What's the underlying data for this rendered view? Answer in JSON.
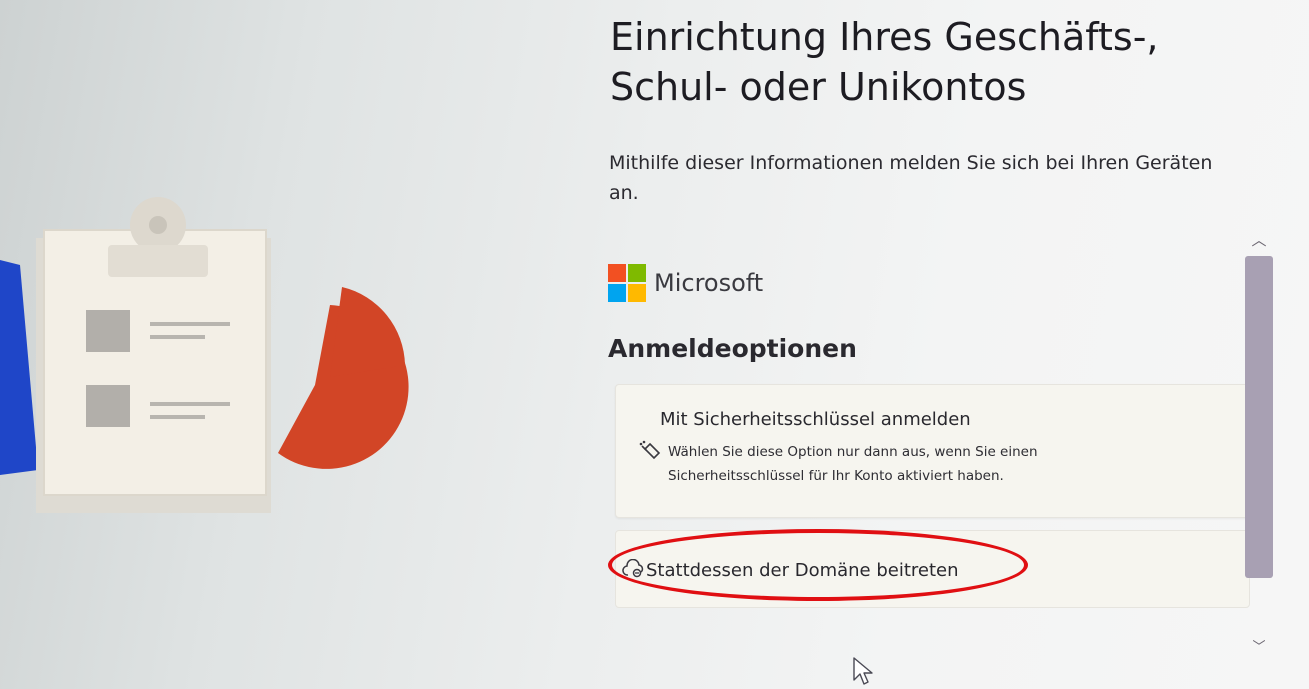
{
  "page": {
    "title_line1": "Einrichtung Ihres Geschäfts-,",
    "title_line2": "Schul- oder Unikontos",
    "description": "Mithilfe dieser Informationen melden Sie sich bei Ihren Geräten an."
  },
  "brand": {
    "name": "Microsoft",
    "logo_colors": [
      "#f25022",
      "#7fba00",
      "#00a4ef",
      "#ffb900"
    ]
  },
  "signin": {
    "section_title": "Anmeldeoptionen",
    "options": [
      {
        "title": "Mit Sicherheitsschlüssel anmelden",
        "icon": "security-key-icon",
        "description": "Wählen Sie diese Option nur dann aus, wenn Sie einen Sicherheitsschlüssel für Ihr Konto aktiviert haben."
      }
    ],
    "domain_join": {
      "label": "Stattdessen der Domäne beitreten",
      "icon": "cloud-link-icon"
    }
  },
  "annotation": {
    "shape": "ellipse",
    "color": "#e00f12"
  },
  "scrollbar": {
    "up_icon": "chevron-up-icon",
    "down_icon": "chevron-down-icon"
  }
}
